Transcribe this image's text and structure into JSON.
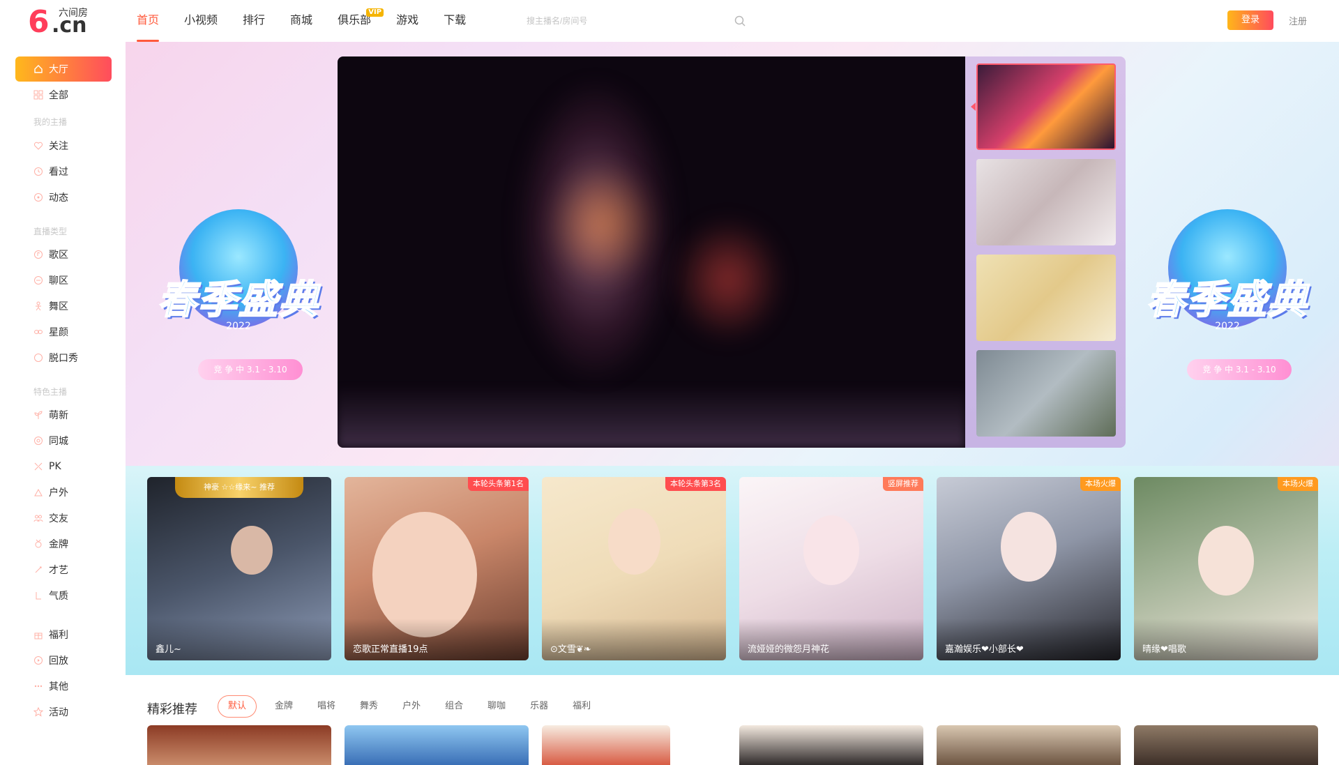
{
  "brand": {
    "logo_mark": "6",
    "logo_suffix": ".cn",
    "name": "六间房"
  },
  "nav": {
    "items": [
      {
        "label": "首页",
        "active": true
      },
      {
        "label": "小视频"
      },
      {
        "label": "排行"
      },
      {
        "label": "商城"
      },
      {
        "label": "俱乐部",
        "badge": "VIP"
      },
      {
        "label": "游戏"
      },
      {
        "label": "下载"
      }
    ]
  },
  "search": {
    "placeholder": "搜主播名/房间号",
    "icon": "search-icon"
  },
  "auth": {
    "login": "登录",
    "register": "注册"
  },
  "sidebar": {
    "items": [
      {
        "label": "大厅",
        "icon": "home-icon",
        "active": true
      },
      {
        "label": "全部",
        "icon": "grid-icon"
      },
      {
        "label": "关注",
        "icon": "heart-icon"
      },
      {
        "label": "看过",
        "icon": "history-icon"
      },
      {
        "label": "动态",
        "icon": "feed-icon"
      },
      {
        "label": "歌区",
        "icon": "music-icon"
      },
      {
        "label": "聊区",
        "icon": "chat-icon"
      },
      {
        "label": "舞区",
        "icon": "dance-icon"
      },
      {
        "label": "星颜",
        "icon": "star-face-icon"
      },
      {
        "label": "脱口秀",
        "icon": "talk-icon"
      },
      {
        "label": "萌新",
        "icon": "sprout-icon"
      },
      {
        "label": "同城",
        "icon": "location-icon"
      },
      {
        "label": "PK",
        "icon": "pk-icon"
      },
      {
        "label": "户外",
        "icon": "outdoor-icon"
      },
      {
        "label": "交友",
        "icon": "friends-icon"
      },
      {
        "label": "金牌",
        "icon": "medal-icon"
      },
      {
        "label": "才艺",
        "icon": "talent-icon"
      },
      {
        "label": "气质",
        "icon": "temperament-icon"
      },
      {
        "label": "福利",
        "icon": "gift-icon"
      },
      {
        "label": "回放",
        "icon": "replay-icon"
      },
      {
        "label": "其他",
        "icon": "more-icon"
      },
      {
        "label": "活动",
        "icon": "event-icon"
      }
    ],
    "groups": [
      "我的主播",
      "直播类型",
      "特色主播"
    ]
  },
  "hero": {
    "event_title": "春季盛典",
    "event_year": "2022",
    "event_date": "3.1 - 3.10",
    "event_cta": "竞 争 中",
    "thumbnails": 4
  },
  "featured": [
    {
      "name": "鑫儿~",
      "banner": "神豪 ☆☆缘来~ 推荐",
      "colors": [
        "#2a2f3a",
        "#6f7f9c"
      ]
    },
    {
      "name": "恋歌正常直播19点",
      "tag": "本轮头条第1名",
      "tag_color": "#ff4d4f",
      "colors": [
        "#d9a38a",
        "#7a4b3c"
      ]
    },
    {
      "name": "⊙文雪❦❧",
      "tag": "本轮头条第3名",
      "tag_color": "#ff4d4f",
      "colors": [
        "#f4e3c5",
        "#c59e7a"
      ]
    },
    {
      "name": "流娅娅的微怨月神花",
      "tag": "竖屏推荐",
      "tag_color": "#ff7a59",
      "colors": [
        "#f6eef2",
        "#d8c0d4"
      ]
    },
    {
      "name": "嘉瀚娱乐❤小部长❤",
      "tag": "本场火爆",
      "tag_color": "#ff9a1f",
      "colors": [
        "#b7bcc9",
        "#2c2c33"
      ]
    },
    {
      "name": "晴缘❤唱歌",
      "tag": "本场火爆",
      "tag_color": "#ff9a1f",
      "colors": [
        "#8aa07a",
        "#e9ded2"
      ]
    }
  ],
  "recommend": {
    "title": "精彩推荐",
    "tabs": [
      {
        "label": "默认",
        "active": true
      },
      {
        "label": "金牌"
      },
      {
        "label": "唱将"
      },
      {
        "label": "舞秀"
      },
      {
        "label": "户外"
      },
      {
        "label": "组合"
      },
      {
        "label": "聊咖"
      },
      {
        "label": "乐器"
      },
      {
        "label": "福利"
      }
    ]
  },
  "colors": {
    "accent": "#ff5a3c",
    "gradient_start": "#ffb81c",
    "gradient_end": "#ff4c5d"
  }
}
